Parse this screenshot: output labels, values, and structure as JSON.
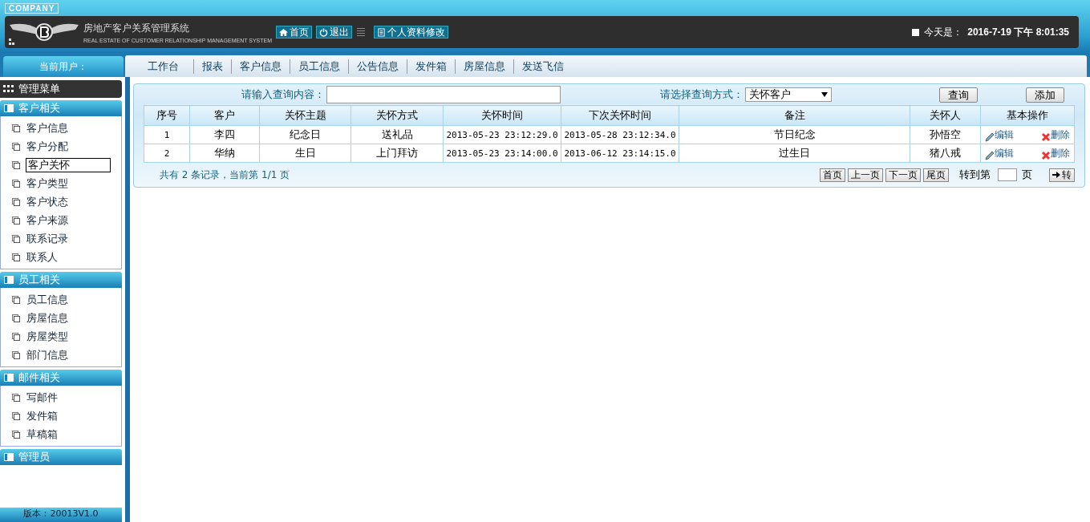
{
  "header": {
    "company": "COMPANY",
    "title": "房地产客户关系管理系统",
    "subtitle": "REAL ESTATE OF CUSTOMER RELATIONSHIP MANAGEMENT SYSTEM",
    "buttons": [
      {
        "label": "首页",
        "kind": "home"
      },
      {
        "label": "退出",
        "kind": "power"
      },
      {
        "label": "个人资料修改",
        "kind": "doc"
      }
    ],
    "date_label": "今天是：",
    "date": "2016-7-19 下午 8:01:35"
  },
  "user_label": "当前用户：",
  "nav": [
    "工作台",
    "报表",
    "客户信息",
    "员工信息",
    "公告信息",
    "发件箱",
    "房屋信息",
    "发送飞信"
  ],
  "sidebar": {
    "title": "管理菜单",
    "groups": [
      {
        "title": "客户相关",
        "items": [
          {
            "label": "客户信息",
            "selected": false
          },
          {
            "label": "客户分配",
            "selected": false
          },
          {
            "label": "客户关怀",
            "selected": true
          },
          {
            "label": "客户类型",
            "selected": false
          },
          {
            "label": "客户状态",
            "selected": false
          },
          {
            "label": "客户来源",
            "selected": false
          },
          {
            "label": "联系记录",
            "selected": false
          },
          {
            "label": "联系人",
            "selected": false
          }
        ]
      },
      {
        "title": "员工相关",
        "items": [
          {
            "label": "员工信息",
            "selected": false
          },
          {
            "label": "房屋信息",
            "selected": false
          },
          {
            "label": "房屋类型",
            "selected": false
          },
          {
            "label": "部门信息",
            "selected": false
          }
        ]
      },
      {
        "title": "邮件相关",
        "items": [
          {
            "label": "写邮件",
            "selected": false
          },
          {
            "label": "发件箱",
            "selected": false
          },
          {
            "label": "草稿箱",
            "selected": false
          }
        ]
      },
      {
        "title": "管理员"
      }
    ],
    "version": "版本：20013V1.0"
  },
  "search": {
    "label": "请输入查询内容：",
    "mode_label": "请选择查询方式：",
    "mode": "关怀客户",
    "buttons": [
      "查询",
      "添加"
    ]
  },
  "table": {
    "columns": [
      "序号",
      "客户",
      "关怀主题",
      "关怀方式",
      "关怀时间",
      "下次关怀时间",
      "备注",
      "关怀人",
      "基本操作"
    ],
    "rows": [
      {
        "cells": [
          "1",
          "李四",
          "纪念日",
          "送礼品",
          "2013-05-23 23:12:29.0",
          "2013-05-28 23:12:34.0",
          "节日纪念",
          "孙悟空"
        ],
        "actions": [
          "编辑",
          "删除"
        ]
      },
      {
        "cells": [
          "2",
          "华纳",
          "生日",
          "上门拜访",
          "2013-05-23 23:14:00.0",
          "2013-06-12 23:14:15.0",
          "过生日",
          "猪八戒"
        ],
        "actions": [
          "编辑",
          "删除"
        ]
      }
    ]
  },
  "pager": {
    "summary": "共有 2 条记录，当前第 1/1 页",
    "buttons": [
      "首页",
      "上一页",
      "下一页",
      "尾页"
    ],
    "goto_label": "转到第",
    "goto_suffix": "页",
    "go": "转"
  }
}
